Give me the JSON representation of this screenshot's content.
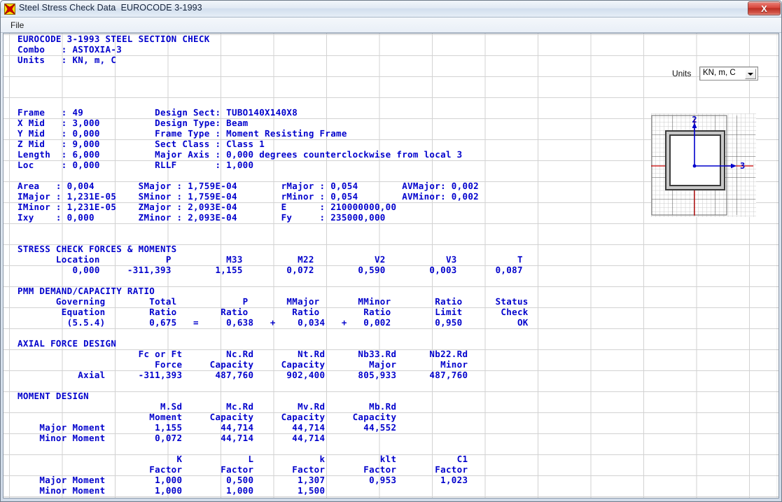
{
  "window": {
    "title": "Steel Stress Check Data  EUROCODE 3-1993",
    "app_icon": "steel-section-icon",
    "close_label": "X"
  },
  "menubar": {
    "items": [
      {
        "label": "File"
      }
    ]
  },
  "units_control": {
    "label": "Units",
    "value": "KN, m, C",
    "options": [
      "KN, m, C"
    ]
  },
  "report": {
    "title": "EUROCODE 3-1993 STEEL SECTION CHECK",
    "combo_label": "Combo",
    "combo_value": "ASTOXIA-3",
    "units_label": "Units",
    "units_value": "KN, m, C",
    "lines": [
      "EUROCODE 3-1993 STEEL SECTION CHECK",
      "Combo   : ASTOXIA-3",
      "Units   : KN, m, C",
      "",
      "",
      "",
      "",
      "Frame   : 49             Design Sect: TUBO140X140X8",
      "X Mid   : 3,000          Design Type: Beam",
      "Y Mid   : 0,000          Frame Type : Moment Resisting Frame",
      "Z Mid   : 9,000          Sect Class : Class 1",
      "Length  : 6,000          Major Axis : 0,000 degrees counterclockwise from local 3",
      "Loc     : 0,000          RLLF       : 1,000",
      "",
      "Area   : 0,004        SMajor : 1,759E-04        rMajor : 0,054        AVMajor: 0,002",
      "IMajor : 1,231E-05    SMinor : 1,759E-04        rMinor : 0,054        AVMinor: 0,002",
      "IMinor : 1,231E-05    ZMajor : 2,093E-04        E      : 210000000,00",
      "Ixy    : 0,000        ZMinor : 2,093E-04        Fy     : 235000,000",
      "",
      "",
      "STRESS CHECK FORCES & MOMENTS",
      "       Location            P          M33          M22           V2           V3           T",
      "          0,000     -311,393        1,155        0,072        0,590        0,003       0,087",
      "",
      "PMM DEMAND/CAPACITY RATIO",
      "       Governing        Total            P       MMajor       MMinor        Ratio      Status",
      "        Equation        Ratio        Ratio        Ratio        Ratio        Limit       Check",
      "         (5.5.4)        0,675   =     0,638   +    0,034   +   0,002        0,950          OK",
      "",
      "AXIAL FORCE DESIGN",
      "                      Fc or Ft        Nc.Rd        Nt.Rd      Nb33.Rd      Nb22.Rd",
      "                         Force     Capacity     Capacity        Major        Minor",
      "           Axial      -311,393      487,760      902,400      805,933      487,760",
      "",
      "MOMENT DESIGN",
      "                          M.Sd        Mc.Rd        Mv.Rd        Mb.Rd",
      "                        Moment     Capacity     Capacity     Capacity",
      "    Major Moment         1,155       44,714       44,714       44,552",
      "    Minor Moment         0,072       44,714       44,714",
      "",
      "                             K            L            k          klt           C1",
      "                        Factor       Factor       Factor       Factor       Factor",
      "    Major Moment         1,000        0,500        1,307        0,953        1,023",
      "    Minor Moment         1,000        1,000        1,500"
    ]
  },
  "frame_properties": {
    "Frame": "49",
    "X Mid": "3,000",
    "Y Mid": "0,000",
    "Z Mid": "9,000",
    "Length": "6,000",
    "Loc": "0,000",
    "Design Sect": "TUBO140X140X8",
    "Design Type": "Beam",
    "Frame Type": "Moment Resisting Frame",
    "Sect Class": "Class 1",
    "Major Axis": "0,000 degrees counterclockwise from local 3",
    "RLLF": "1,000"
  },
  "section_properties": {
    "Area": "0,004",
    "IMajor": "1,231E-05",
    "IMinor": "1,231E-05",
    "Ixy": "0,000",
    "SMajor": "1,759E-04",
    "SMinor": "1,759E-04",
    "ZMajor": "2,093E-04",
    "ZMinor": "2,093E-04",
    "rMajor": "0,054",
    "rMinor": "0,054",
    "E": "210000000,00",
    "Fy": "235000,000",
    "AVMajor": "0,002",
    "AVMinor": "0,002"
  },
  "stress_check_forces": {
    "heading": "STRESS CHECK FORCES & MOMENTS",
    "columns": [
      "Location",
      "P",
      "M33",
      "M22",
      "V2",
      "V3",
      "T"
    ],
    "values": [
      "0,000",
      "-311,393",
      "1,155",
      "0,072",
      "0,590",
      "0,003",
      "0,087"
    ]
  },
  "pmm_ratio": {
    "heading": "PMM DEMAND/CAPACITY RATIO",
    "columns": [
      "Governing Equation",
      "Total Ratio",
      "P Ratio",
      "MMajor Ratio",
      "MMinor Ratio",
      "Ratio Limit",
      "Status Check"
    ],
    "values": [
      "(5.5.4)",
      "0,675",
      "0,638",
      "0,034",
      "0,002",
      "0,950",
      "OK"
    ],
    "operators": [
      "=",
      "+",
      "+"
    ]
  },
  "axial_force_design": {
    "heading": "AXIAL FORCE DESIGN",
    "columns": [
      "Fc or Ft Force",
      "Nc.Rd Capacity",
      "Nt.Rd Capacity",
      "Nb33.Rd Major",
      "Nb22.Rd Minor"
    ],
    "row_label": "Axial",
    "values": [
      "-311,393",
      "487,760",
      "902,400",
      "805,933",
      "487,760"
    ]
  },
  "moment_design": {
    "heading": "MOMENT DESIGN",
    "columns": [
      "M.Sd Moment",
      "Mc.Rd Capacity",
      "Mv.Rd Capacity",
      "Mb.Rd Capacity"
    ],
    "rows": [
      {
        "label": "Major Moment",
        "values": [
          "1,155",
          "44,714",
          "44,714",
          "44,552"
        ]
      },
      {
        "label": "Minor Moment",
        "values": [
          "0,072",
          "44,714",
          "44,714",
          ""
        ]
      }
    ]
  },
  "factors": {
    "columns": [
      "K Factor",
      "L Factor",
      "k Factor",
      "klt Factor",
      "C1 Factor"
    ],
    "rows": [
      {
        "label": "Major Moment",
        "values": [
          "1,000",
          "0,500",
          "1,307",
          "0,953",
          "1,023"
        ]
      },
      {
        "label": "Minor Moment",
        "values": [
          "1,000",
          "1,000",
          "1,500",
          "",
          ""
        ]
      }
    ]
  },
  "section_diagram": {
    "shape": "hollow-square-tube",
    "axis_2_label": "2",
    "axis_3_label": "3",
    "axis_color": "#cc0000",
    "local_axis_color": "#0000cc",
    "wall_fill": "#c8c8c8",
    "wall_stroke": "#3a3a3a"
  },
  "colors": {
    "text_blue": "#0000cc",
    "grid_gray": "#b8b8b8",
    "background": "#ffffff",
    "close_red": "#d9483d"
  }
}
